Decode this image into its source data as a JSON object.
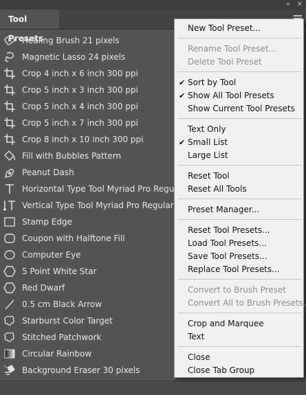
{
  "panel": {
    "tab_label": "Tool Presets"
  },
  "presets": [
    {
      "label": "Healing Brush 21 pixels",
      "icon": "healing-brush-icon"
    },
    {
      "label": "Magnetic Lasso 24 pixels",
      "icon": "magnetic-lasso-icon"
    },
    {
      "label": "Crop 4 inch x 6 inch 300 ppi",
      "icon": "crop-icon"
    },
    {
      "label": "Crop 5 inch x 3 inch 300 ppi",
      "icon": "crop-icon"
    },
    {
      "label": "Crop 5 inch x 4 inch 300 ppi",
      "icon": "crop-icon"
    },
    {
      "label": "Crop 5 inch x 7 inch 300 ppi",
      "icon": "crop-icon"
    },
    {
      "label": "Crop 8 inch x 10 inch 300 ppi",
      "icon": "crop-icon"
    },
    {
      "label": "Fill with Bubbles Pattern",
      "icon": "paint-bucket-icon"
    },
    {
      "label": "Peanut Dash",
      "icon": "pen-icon"
    },
    {
      "label": "Horizontal Type Tool Myriad Pro Regular 24 pt",
      "icon": "horizontal-type-icon"
    },
    {
      "label": "Vertical Type Tool Myriad Pro Regular 24 pt",
      "icon": "vertical-type-icon"
    },
    {
      "label": "Stamp Edge",
      "icon": "rectangle-shape-icon"
    },
    {
      "label": "Coupon with Halftone Fill",
      "icon": "rounded-rectangle-icon"
    },
    {
      "label": "Computer Eye",
      "icon": "ellipse-icon"
    },
    {
      "label": "5 Point White Star",
      "icon": "polygon-icon"
    },
    {
      "label": "Red Dwarf",
      "icon": "polygon-icon"
    },
    {
      "label": "0.5 cm Black Arrow",
      "icon": "line-icon"
    },
    {
      "label": "Starburst Color Target",
      "icon": "custom-shape-icon"
    },
    {
      "label": "Stitched Patchwork",
      "icon": "custom-shape-icon"
    },
    {
      "label": "Circular Rainbow",
      "icon": "gradient-icon"
    },
    {
      "label": "Background Eraser 30 pixels",
      "icon": "background-eraser-icon"
    }
  ],
  "menu": {
    "new_tool_preset": "New Tool Preset...",
    "rename_tool_preset": "Rename Tool Preset...",
    "delete_tool_preset": "Delete Tool Preset",
    "sort_by_tool": "Sort by Tool",
    "show_all_tool_presets": "Show All Tool Presets",
    "show_current_tool_presets": "Show Current Tool Presets",
    "text_only": "Text Only",
    "small_list": "Small List",
    "large_list": "Large List",
    "reset_tool": "Reset Tool",
    "reset_all_tools": "Reset All Tools",
    "preset_manager": "Preset Manager...",
    "reset_tool_presets": "Reset Tool Presets...",
    "load_tool_presets": "Load Tool Presets...",
    "save_tool_presets": "Save Tool Presets...",
    "replace_tool_presets": "Replace Tool Presets...",
    "convert_to_brush_preset": "Convert to Brush Preset",
    "convert_all_to_brush_presets": "Convert All to Brush Presets...",
    "crop_and_marquee": "Crop and Marquee",
    "text": "Text",
    "close": "Close",
    "close_tab_group": "Close Tab Group",
    "checkmark": "✔"
  },
  "colors": {
    "panel_bg": "#535353",
    "menu_bg": "#f1f1f1",
    "disabled_text": "#8d8d8d"
  }
}
